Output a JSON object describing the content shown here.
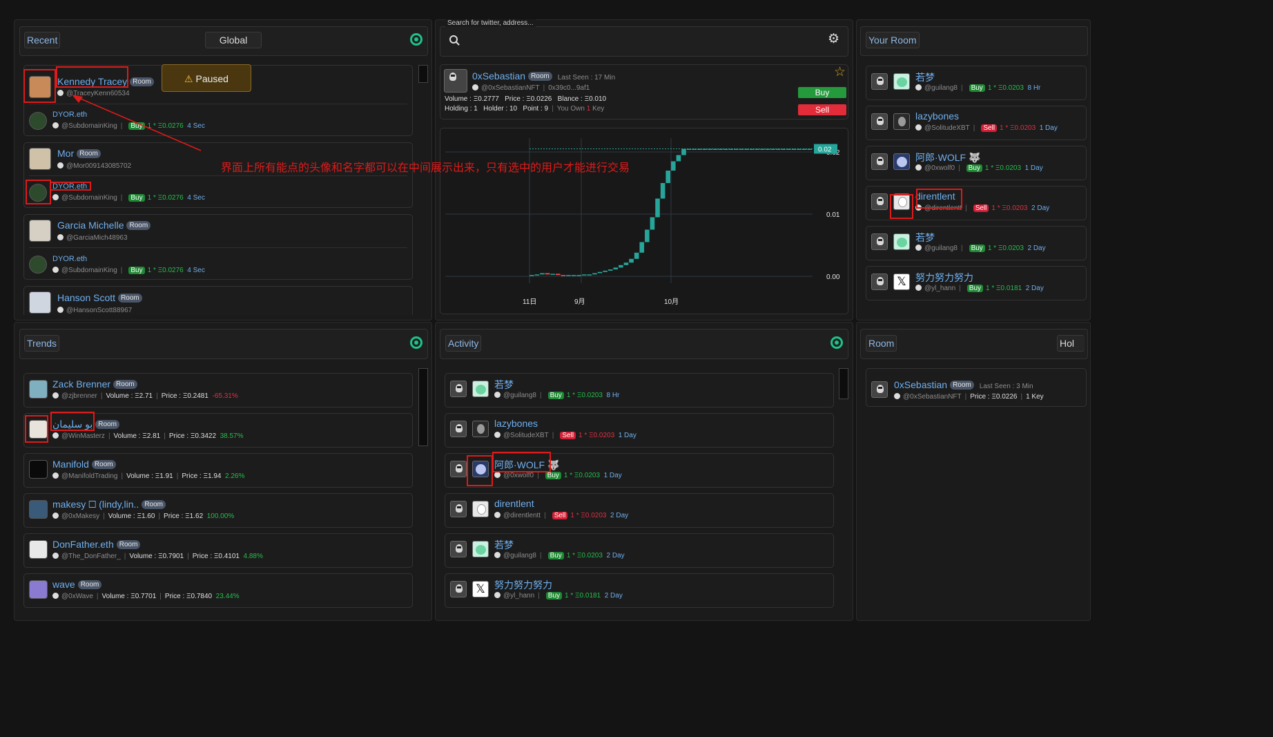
{
  "recent_panel": {
    "tab_recent": "Recent",
    "tab_global": "Global",
    "paused_label": "Paused",
    "cards": [
      {
        "name": "Kennedy Tracey",
        "room": "Room",
        "handle": "@TraceyKenn60534"
      },
      {
        "name": "DYOR.eth",
        "handle": "@SubdomainKing",
        "action": "Buy",
        "amount": "1 * Ξ0.0276",
        "time": "4 Sec"
      },
      {
        "name": "Mor",
        "room": "Room",
        "handle": "@Mor009143085702"
      },
      {
        "name": "DYOR.eth",
        "handle": "@SubdomainKing",
        "action": "Buy",
        "amount": "1 * Ξ0.0276",
        "time": "4 Sec"
      },
      {
        "name": "Garcia Michelle",
        "room": "Room",
        "handle": "@GarciaMich48963"
      },
      {
        "name": "DYOR.eth",
        "handle": "@SubdomainKing",
        "action": "Buy",
        "amount": "1 * Ξ0.0276",
        "time": "4 Sec"
      },
      {
        "name": "Hanson Scott",
        "room": "Room",
        "handle": "@HansonScott88967"
      }
    ]
  },
  "search": {
    "label": "Search for twitter, address...",
    "placeholder": ""
  },
  "profile": {
    "name": "0xSebastian",
    "room": "Room",
    "last_seen": "Last Seen : 17 Min",
    "handle": "@0xSebastianNFT",
    "address": "0x39c0...9af1",
    "volume": "Volume : Ξ0.2777",
    "price": "Price : Ξ0.0226",
    "balance": "Blance : Ξ0.010",
    "holding": "Holding : 1",
    "holder": "Holder : 10",
    "point": "Point : 9",
    "you_own_prefix": "You Own",
    "you_own_count": "1",
    "you_own_suffix": "Key",
    "buy_label": "Buy",
    "sell_label": "Sell"
  },
  "annotation_text": "界面上所有能点的头像和名字都可以在中间展示出来，只有选中的用户才能进行交易",
  "your_room": {
    "tab": "Your Room",
    "items": [
      {
        "name": "若梦",
        "handle": "@guilang8",
        "action": "Buy",
        "amount": "1 * Ξ0.0203",
        "time": "8 Hr"
      },
      {
        "name": "lazybones",
        "handle": "@SolitudeXBT",
        "action": "Sell",
        "amount": "1 * Ξ0.0203",
        "time": "1 Day"
      },
      {
        "name": "阿郎·WOLF 🐺",
        "handle": "@0xwolf0",
        "action": "Buy",
        "amount": "1 * Ξ0.0203",
        "time": "1 Day"
      },
      {
        "name": "direntlent",
        "handle": "@direntlentt",
        "action": "Sell",
        "amount": "1 * Ξ0.0203",
        "time": "2 Day"
      },
      {
        "name": "若梦",
        "handle": "@guilang8",
        "action": "Buy",
        "amount": "1 * Ξ0.0203",
        "time": "2 Day"
      },
      {
        "name": "努力努力努力",
        "handle": "@yl_hann",
        "action": "Buy",
        "amount": "1 * Ξ0.0181",
        "time": "2 Day"
      }
    ]
  },
  "trends": {
    "tab": "Trends",
    "items": [
      {
        "name": "Zack Brenner",
        "room": "Room",
        "handle": "@zjbrenner",
        "volume": "Volume : Ξ2.71",
        "price": "Price : Ξ0.2481",
        "change": "-65.31%",
        "dir": "down"
      },
      {
        "name": "بو سليمان",
        "room": "Room",
        "handle": "@WinMasterz",
        "volume": "Volume : Ξ2.81",
        "price": "Price : Ξ0.3422",
        "change": "38.57%",
        "dir": "up"
      },
      {
        "name": "Manifold",
        "room": "Room",
        "handle": "@ManifoldTrading",
        "volume": "Volume : Ξ1.91",
        "price": "Price : Ξ1.94",
        "change": "2.26%",
        "dir": "up"
      },
      {
        "name": "makesy 🞏 (lindy,lin..",
        "room": "Room",
        "handle": "@0xMakesy",
        "volume": "Volume : Ξ1.60",
        "price": "Price : Ξ1.62",
        "change": "100.00%",
        "dir": "up"
      },
      {
        "name": "DonFather.eth",
        "room": "Room",
        "handle": "@The_DonFather_",
        "volume": "Volume : Ξ0.7901",
        "price": "Price : Ξ0.4101",
        "change": "4.88%",
        "dir": "up"
      },
      {
        "name": "wave",
        "room": "Room",
        "handle": "@0xWave",
        "volume": "Volume : Ξ0.7701",
        "price": "Price : Ξ0.7840",
        "change": "23.44%",
        "dir": "up"
      }
    ]
  },
  "activity": {
    "tab": "Activity",
    "items": [
      {
        "name": "若梦",
        "handle": "@guilang8",
        "action": "Buy",
        "amount": "1 * Ξ0.0203",
        "time": "8 Hr"
      },
      {
        "name": "lazybones",
        "handle": "@SolitudeXBT",
        "action": "Sell",
        "amount": "1 * Ξ0.0203",
        "time": "1 Day"
      },
      {
        "name": "阿郎·WOLF 🐺",
        "handle": "@0xwolf0",
        "action": "Buy",
        "amount": "1 * Ξ0.0203",
        "time": "1 Day"
      },
      {
        "name": "direntlent",
        "handle": "@direntlentt",
        "action": "Sell",
        "amount": "1 * Ξ0.0203",
        "time": "2 Day"
      },
      {
        "name": "若梦",
        "handle": "@guilang8",
        "action": "Buy",
        "amount": "1 * Ξ0.0203",
        "time": "2 Day"
      },
      {
        "name": "努力努力努力",
        "handle": "@yl_hann",
        "action": "Buy",
        "amount": "1 * Ξ0.0181",
        "time": "2 Day"
      }
    ]
  },
  "room_panel": {
    "tab_room": "Room",
    "tab_holders": "Hol",
    "item": {
      "name": "0xSebastian",
      "room": "Room",
      "last_seen": "Last Seen : 3 Min",
      "handle": "@0xSebastianNFT",
      "price": "Price : Ξ0.0226",
      "keys": "1 Key"
    }
  },
  "chart_data": {
    "type": "candlestick",
    "x_tick_labels": [
      "11日",
      "9月",
      "10月"
    ],
    "y_tick_labels": [
      "0.00",
      "0.01",
      "0.02"
    ],
    "ylim": [
      0,
      0.02
    ],
    "last_price_label": "0.02",
    "series": [
      {
        "name": "",
        "values": [
          0.0002,
          0.0003,
          0.0005,
          0.0003,
          0.0004,
          0.0002,
          0.0001,
          0.0002,
          0.0002,
          0.0002,
          0.0003,
          0.0003,
          0.0005,
          0.0007,
          0.0009,
          0.0011,
          0.0014,
          0.0018,
          0.0022,
          0.0028,
          0.0038,
          0.0055,
          0.0075,
          0.0095,
          0.0125,
          0.015,
          0.017,
          0.0185,
          0.0195,
          0.0205,
          0.0205,
          0.0205,
          0.0205,
          0.0205,
          0.0205,
          0.0205,
          0.0205,
          0.0205,
          0.0205,
          0.0205,
          0.0205,
          0.0205,
          0.0205,
          0.0205,
          0.0205,
          0.0205,
          0.0205,
          0.0205,
          0.0205,
          0.0205,
          0.0205,
          0.0205,
          0.0205,
          0.0205
        ]
      }
    ],
    "grid": true,
    "colors": {
      "up": "#26a69a",
      "down": "#ef5350",
      "last": "#26a69a"
    }
  },
  "colors": {
    "accent": "#6fb0ef",
    "buy": "#1f8a34",
    "sell": "#d31f36",
    "up": "#23c04a",
    "down": "#e32f45",
    "annotation": "#e01a1a"
  }
}
